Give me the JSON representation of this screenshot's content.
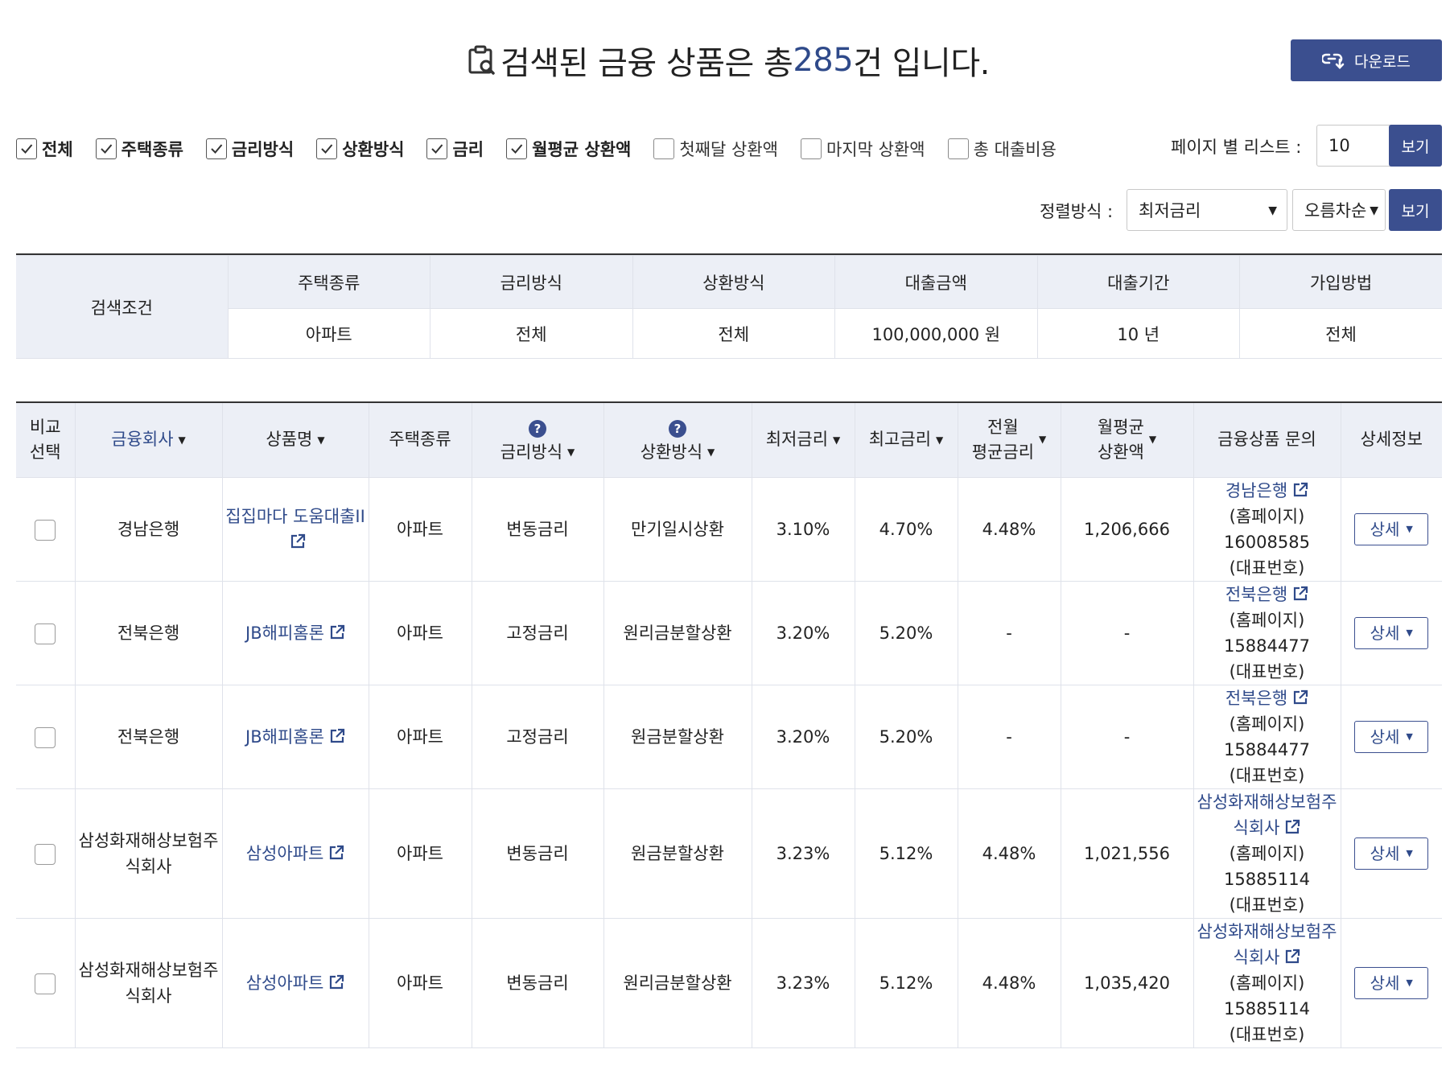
{
  "header": {
    "title_prefix": "검색된 금융 상품은 총 ",
    "count": "285",
    "title_suffix": "건 입니다.",
    "download_label": "다운로드"
  },
  "filters": [
    {
      "label": "전체",
      "checked": true
    },
    {
      "label": "주택종류",
      "checked": true
    },
    {
      "label": "금리방식",
      "checked": true
    },
    {
      "label": "상환방식",
      "checked": true
    },
    {
      "label": "금리",
      "checked": true
    },
    {
      "label": "월평균 상환액",
      "checked": true
    },
    {
      "label": "첫째달 상환액",
      "checked": false
    },
    {
      "label": "마지막 상환액",
      "checked": false
    },
    {
      "label": "총 대출비용",
      "checked": false
    }
  ],
  "paging": {
    "label": "페이지 별 리스트 :",
    "value": "10",
    "view_label": "보기"
  },
  "sorting": {
    "label": "정렬방식 :",
    "field": "최저금리",
    "order": "오름차순",
    "view_label": "보기"
  },
  "conditions": {
    "label": "검색조건",
    "headers": [
      "주택종류",
      "금리방식",
      "상환방식",
      "대출금액",
      "대출기간",
      "가입방법"
    ],
    "values": [
      "아파트",
      "전체",
      "전체",
      "100,000,000 원",
      "10 년",
      "전체"
    ]
  },
  "table": {
    "headers": {
      "compare_1": "비교",
      "compare_2": "선택",
      "company": "금융회사",
      "product": "상품명",
      "housing": "주택종류",
      "rate_type": "금리방식",
      "repay_type": "상환방식",
      "min_rate": "최저금리",
      "max_rate": "최고금리",
      "avg_rate_1": "전월",
      "avg_rate_2": "평균금리",
      "monthly_1": "월평균",
      "monthly_2": "상환액",
      "inquiry": "금융상품 문의",
      "detail": "상세정보"
    },
    "help_icon": "?",
    "detail_label": "상세",
    "rows": [
      {
        "company": "경남은행",
        "product": "집집마다 도움대출II",
        "housing": "아파트",
        "rate_type": "변동금리",
        "repay_type": "만기일시상환",
        "min_rate": "3.10%",
        "max_rate": "4.70%",
        "avg_rate": "4.48%",
        "monthly": "1,206,666",
        "inq_name_1": "경남은행",
        "inq_name_2": "",
        "inq_home": "(홈페이지)",
        "inq_phone": "16008585",
        "inq_phone_label": "(대표번호)"
      },
      {
        "company": "전북은행",
        "product": "JB해피홈론",
        "housing": "아파트",
        "rate_type": "고정금리",
        "repay_type": "원리금분할상환",
        "min_rate": "3.20%",
        "max_rate": "5.20%",
        "avg_rate": "-",
        "monthly": "-",
        "inq_name_1": "전북은행",
        "inq_name_2": "",
        "inq_home": "(홈페이지)",
        "inq_phone": "15884477",
        "inq_phone_label": "(대표번호)"
      },
      {
        "company": "전북은행",
        "product": "JB해피홈론",
        "housing": "아파트",
        "rate_type": "고정금리",
        "repay_type": "원금분할상환",
        "min_rate": "3.20%",
        "max_rate": "5.20%",
        "avg_rate": "-",
        "monthly": "-",
        "inq_name_1": "전북은행",
        "inq_name_2": "",
        "inq_home": "(홈페이지)",
        "inq_phone": "15884477",
        "inq_phone_label": "(대표번호)"
      },
      {
        "company": "삼성화재해상보험주식회사",
        "product": "삼성아파트",
        "housing": "아파트",
        "rate_type": "변동금리",
        "repay_type": "원금분할상환",
        "min_rate": "3.23%",
        "max_rate": "5.12%",
        "avg_rate": "4.48%",
        "monthly": "1,021,556",
        "inq_name_1": "삼성화재해상보험주",
        "inq_name_2": "식회사",
        "inq_home": "(홈페이지)",
        "inq_phone": "15885114",
        "inq_phone_label": "(대표번호)"
      },
      {
        "company": "삼성화재해상보험주식회사",
        "product": "삼성아파트",
        "housing": "아파트",
        "rate_type": "변동금리",
        "repay_type": "원리금분할상환",
        "min_rate": "3.23%",
        "max_rate": "5.12%",
        "avg_rate": "4.48%",
        "monthly": "1,035,420",
        "inq_name_1": "삼성화재해상보험주",
        "inq_name_2": "식회사",
        "inq_home": "(홈페이지)",
        "inq_phone": "15885114",
        "inq_phone_label": "(대표번호)"
      }
    ]
  }
}
